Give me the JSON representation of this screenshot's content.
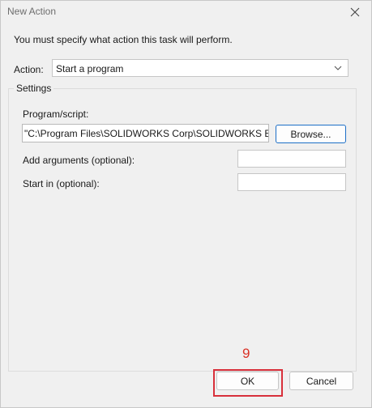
{
  "window": {
    "title": "New Action"
  },
  "instruction": "You must specify what action this task will perform.",
  "action": {
    "label": "Action:",
    "selected": "Start a program"
  },
  "settings": {
    "group_label": "Settings",
    "program_label": "Program/script:",
    "program_value": "\"C:\\Program Files\\SOLIDWORKS Corp\\SOLIDWORKS Elec",
    "browse_label": "Browse...",
    "args_label": "Add arguments (optional):",
    "args_value": "",
    "start_in_label": "Start in (optional):",
    "start_in_value": ""
  },
  "annotation": {
    "step_number": "9",
    "color": "#d8303b"
  },
  "buttons": {
    "ok_label": "OK",
    "cancel_label": "Cancel"
  }
}
